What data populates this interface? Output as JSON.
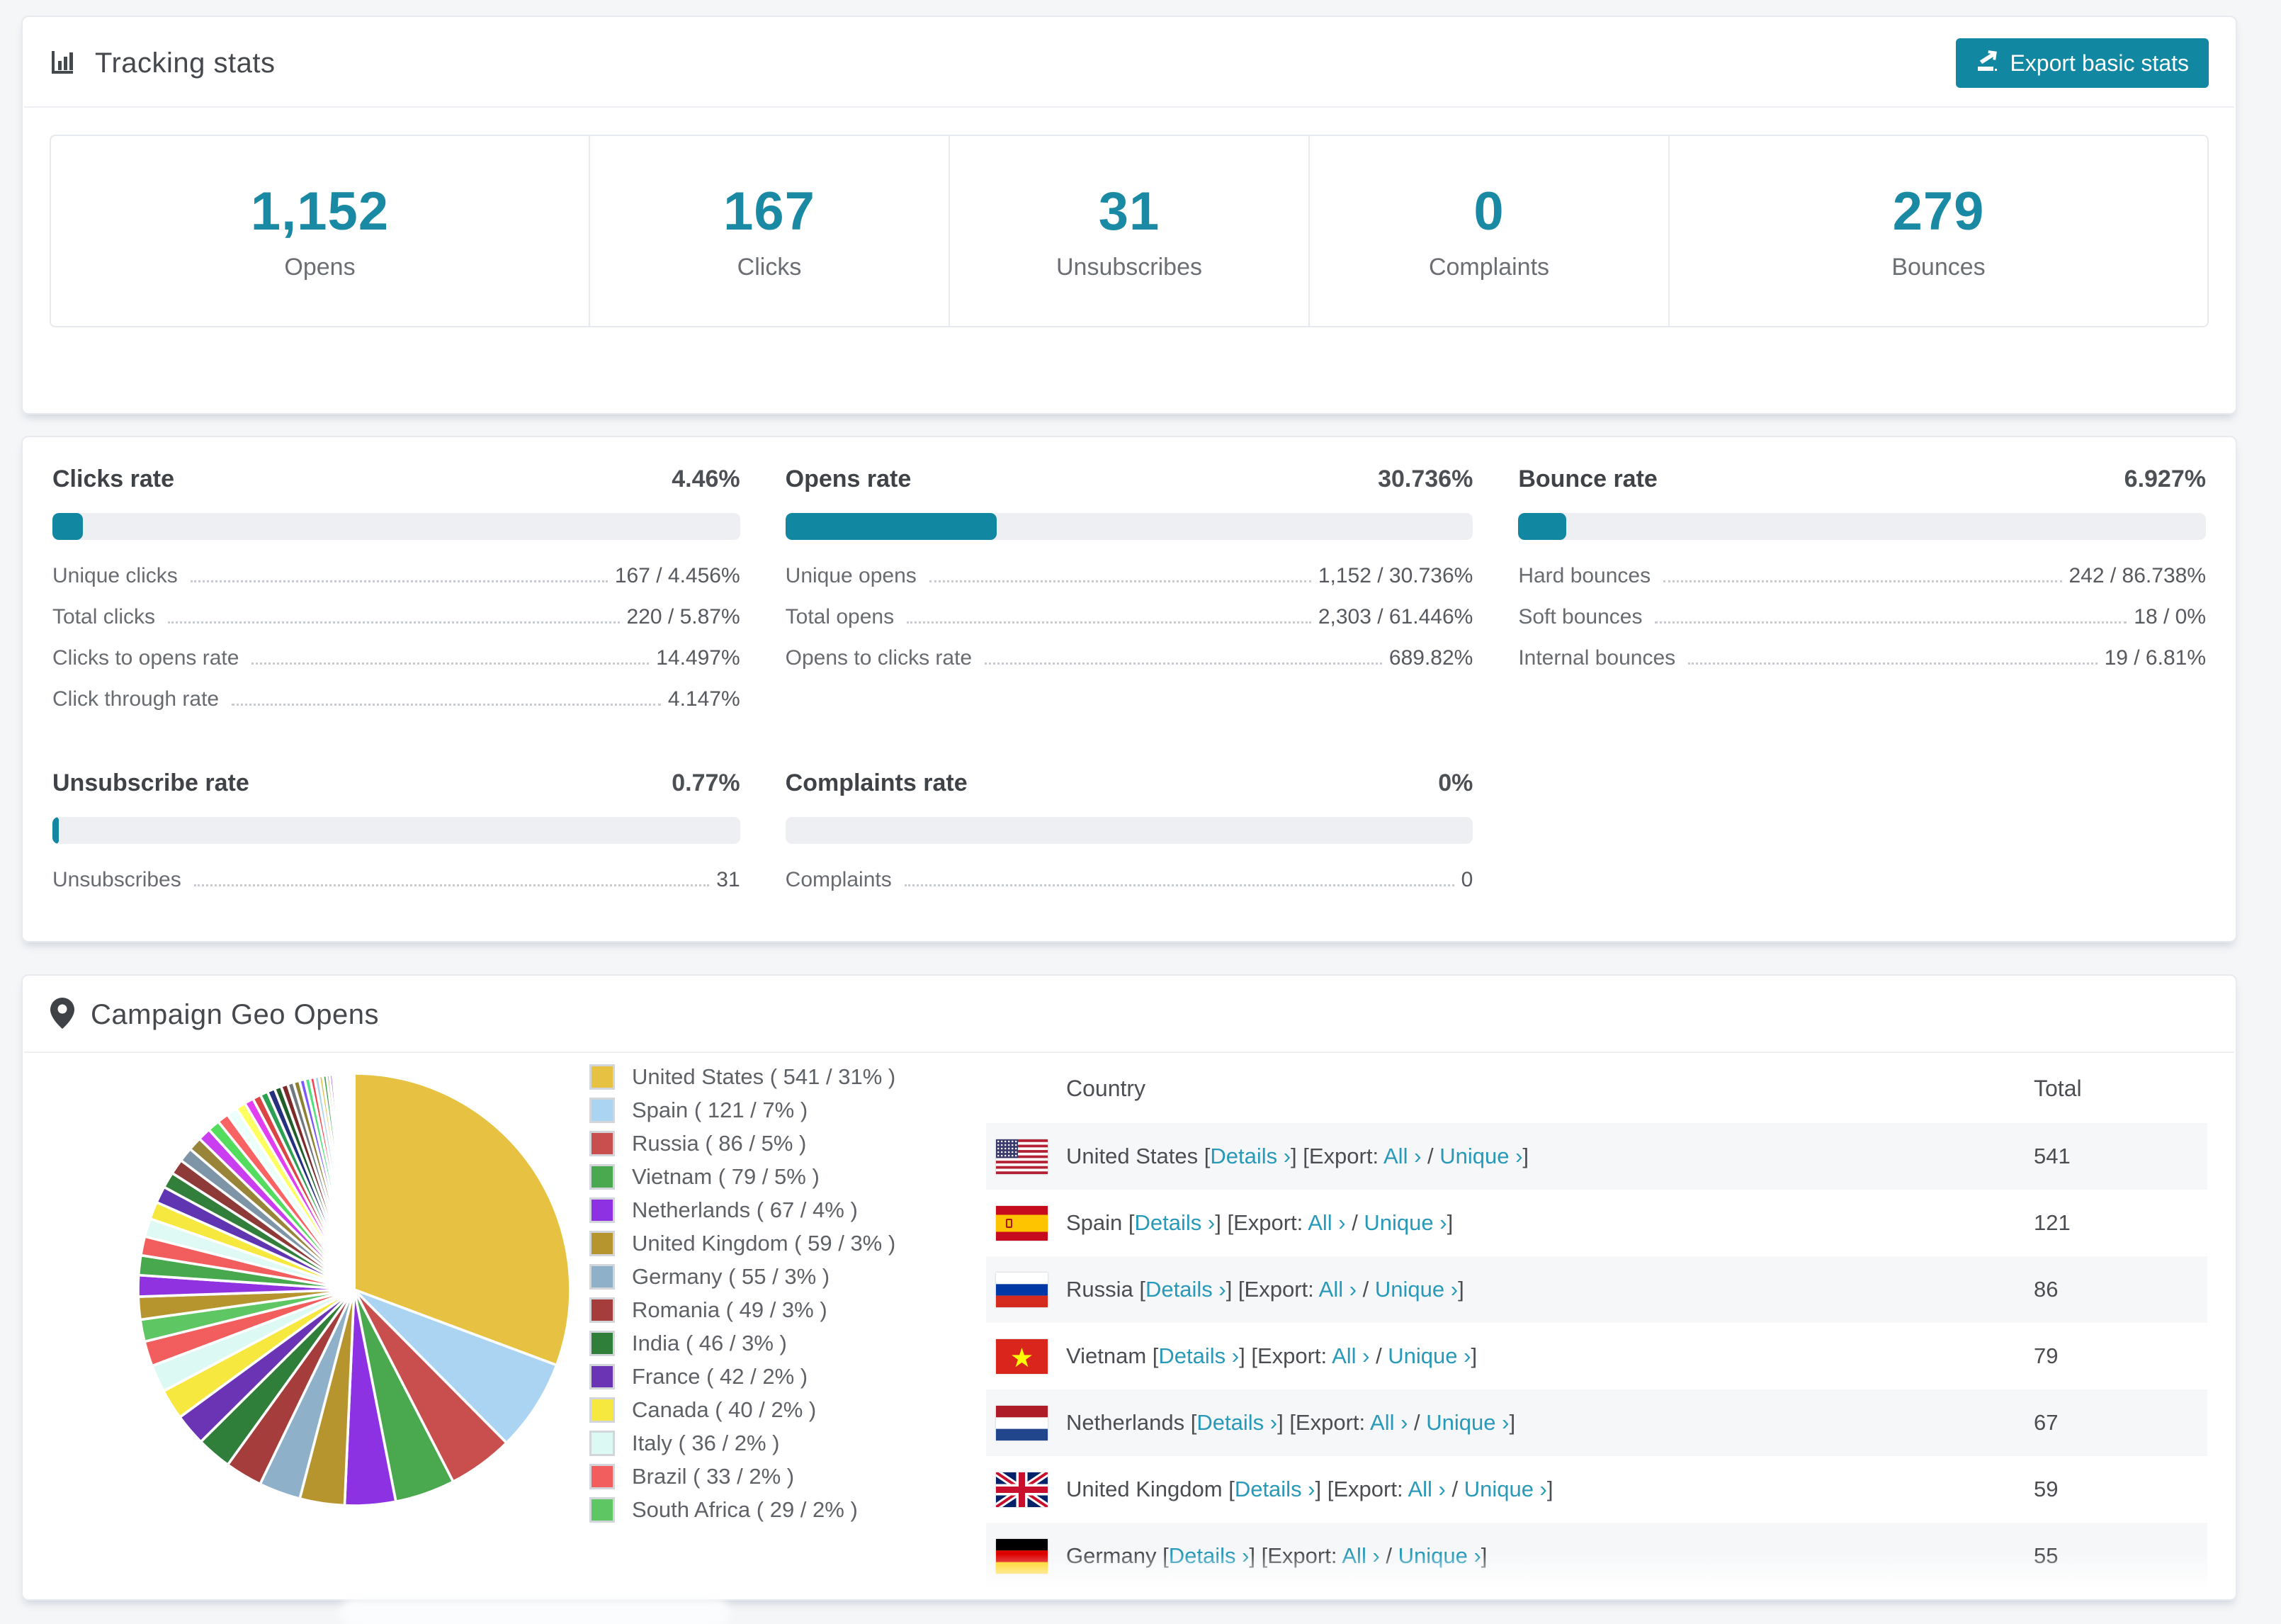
{
  "colors": {
    "accent_teal": "#1187a1",
    "number_teal": "#1a89a3",
    "link_teal": "#2899b9",
    "bar_track": "#edeff2",
    "row_stripe": "#f6f7f9"
  },
  "tracking": {
    "title": "Tracking stats",
    "export_button": "Export basic stats",
    "stats": [
      {
        "value": "1,152",
        "label": "Opens"
      },
      {
        "value": "167",
        "label": "Clicks"
      },
      {
        "value": "31",
        "label": "Unsubscribes"
      },
      {
        "value": "0",
        "label": "Complaints"
      },
      {
        "value": "279",
        "label": "Bounces"
      }
    ]
  },
  "rates": {
    "sections": [
      {
        "title": "Clicks rate",
        "value": "4.46%",
        "percent": 4.46,
        "rows": [
          {
            "label": "Unique clicks",
            "value": "167 / 4.456%"
          },
          {
            "label": "Total clicks",
            "value": "220 / 5.87%"
          },
          {
            "label": "Clicks to opens rate",
            "value": "14.497%"
          },
          {
            "label": "Click through rate",
            "value": "4.147%"
          }
        ]
      },
      {
        "title": "Opens rate",
        "value": "30.736%",
        "percent": 30.736,
        "rows": [
          {
            "label": "Unique opens",
            "value": "1,152 / 30.736%"
          },
          {
            "label": "Total opens",
            "value": "2,303 / 61.446%"
          },
          {
            "label": "Opens to clicks rate",
            "value": "689.82%"
          }
        ]
      },
      {
        "title": "Bounce rate",
        "value": "6.927%",
        "percent": 6.927,
        "rows": [
          {
            "label": "Hard bounces",
            "value": "242 / 86.738%"
          },
          {
            "label": "Soft bounces",
            "value": "18 / 0%"
          },
          {
            "label": "Internal bounces",
            "value": "19 / 6.81%"
          }
        ]
      },
      {
        "title": "Unsubscribe rate",
        "value": "0.77%",
        "percent": 0.77,
        "rows": [
          {
            "label": "Unsubscribes",
            "value": "31"
          }
        ]
      },
      {
        "title": "Complaints rate",
        "value": "0%",
        "percent": 0,
        "rows": [
          {
            "label": "Complaints",
            "value": "0"
          }
        ]
      }
    ]
  },
  "geo": {
    "title": "Campaign Geo Opens",
    "legend": [
      {
        "label": "United States ( 541 / 31% )",
        "color": "#e7c242"
      },
      {
        "label": "Spain ( 121 / 7% )",
        "color": "#abd4f3"
      },
      {
        "label": "Russia ( 86 / 5% )",
        "color": "#c84f4e"
      },
      {
        "label": "Vietnam ( 79 / 5% )",
        "color": "#4aa84f"
      },
      {
        "label": "Netherlands ( 67 / 4% )",
        "color": "#8d32e2"
      },
      {
        "label": "United Kingdom ( 59 / 3% )",
        "color": "#b6952e"
      },
      {
        "label": "Germany ( 55 / 3% )",
        "color": "#8fb0c9"
      },
      {
        "label": "Romania ( 49 / 3% )",
        "color": "#a43d3b"
      },
      {
        "label": "India ( 46 / 3% )",
        "color": "#2f7f3a"
      },
      {
        "label": "France ( 42 / 2% )",
        "color": "#6a34b4"
      },
      {
        "label": "Canada ( 40 / 2% )",
        "color": "#f6e83e"
      },
      {
        "label": "Italy ( 36 / 2% )",
        "color": "#dcfaf3"
      },
      {
        "label": "Brazil ( 33 / 2% )",
        "color": "#f25d5d"
      },
      {
        "label": "South Africa ( 29 / 2% )",
        "color": "#5ec763"
      }
    ],
    "table": {
      "headers": {
        "country": "Country",
        "total": "Total"
      },
      "fmt": {
        "open": " [",
        "close": "]",
        "details": "Details ›",
        "export": "[Export: ",
        "all": "All ›",
        "sep": " / ",
        "unique": "Unique ›",
        "space": " "
      },
      "rows": [
        {
          "country": "United States",
          "flag": "us",
          "total": "541"
        },
        {
          "country": "Spain",
          "flag": "es",
          "total": "121"
        },
        {
          "country": "Russia",
          "flag": "ru",
          "total": "86"
        },
        {
          "country": "Vietnam",
          "flag": "vn",
          "total": "79"
        },
        {
          "country": "Netherlands",
          "flag": "nl",
          "total": "67"
        },
        {
          "country": "United Kingdom",
          "flag": "gb",
          "total": "59"
        },
        {
          "country": "Germany",
          "flag": "de",
          "total": "55",
          "partial": true
        }
      ]
    }
  },
  "chart_data": {
    "type": "pie",
    "title": "Campaign Geo Opens",
    "legend_position": "right",
    "start_angle_deg": 0,
    "direction": "clockwise",
    "labeled_slices": [
      {
        "label": "United States",
        "value": 541,
        "pct": "31%",
        "color": "#e7c242"
      },
      {
        "label": "Spain",
        "value": 121,
        "pct": "7%",
        "color": "#abd4f3"
      },
      {
        "label": "Russia",
        "value": 86,
        "pct": "5%",
        "color": "#c84f4e"
      },
      {
        "label": "Vietnam",
        "value": 79,
        "pct": "5%",
        "color": "#4aa84f"
      },
      {
        "label": "Netherlands",
        "value": 67,
        "pct": "4%",
        "color": "#8d32e2"
      },
      {
        "label": "United Kingdom",
        "value": 59,
        "pct": "3%",
        "color": "#b6952e"
      },
      {
        "label": "Germany",
        "value": 55,
        "pct": "3%",
        "color": "#8fb0c9"
      },
      {
        "label": "Romania",
        "value": 49,
        "pct": "3%",
        "color": "#a43d3b"
      },
      {
        "label": "India",
        "value": 46,
        "pct": "3%",
        "color": "#2f7f3a"
      },
      {
        "label": "France",
        "value": 42,
        "pct": "2%",
        "color": "#6a34b4"
      },
      {
        "label": "Canada",
        "value": 40,
        "pct": "2%",
        "color": "#f6e83e"
      },
      {
        "label": "Italy",
        "value": 36,
        "pct": "2%",
        "color": "#dcfaf3"
      },
      {
        "label": "Brazil",
        "value": 33,
        "pct": "2%",
        "color": "#f25d5d"
      },
      {
        "label": "South Africa",
        "value": 29,
        "pct": "2%",
        "color": "#5ec763"
      }
    ],
    "other_slices": {
      "note": "many small unlabeled countries fanning to 12 o'clock",
      "values": [
        30,
        28,
        26,
        25,
        24,
        23,
        22,
        21,
        20,
        19,
        18,
        17,
        16,
        15,
        14,
        13,
        12,
        11,
        10,
        10,
        9,
        9,
        8,
        8,
        7,
        7,
        6,
        6,
        5,
        5,
        4,
        4,
        3,
        3,
        3,
        2,
        2,
        2,
        2,
        1,
        1,
        1,
        1,
        1,
        1,
        1,
        1,
        1,
        1,
        1
      ],
      "colors": [
        "#b6952e",
        "#9032e0",
        "#47a84e",
        "#f25d5d",
        "#dffaf4",
        "#f6e83e",
        "#5f35b2",
        "#317f3b",
        "#8e3a38",
        "#7e94a7",
        "#99853a",
        "#c93ff0",
        "#54dc5f",
        "#fa6363",
        "#ebfffb",
        "#feff60",
        "#e23ef2",
        "#dc4545",
        "#2ba052",
        "#25317e",
        "#1f5f2a",
        "#7d2a2a",
        "#70787f",
        "#8d8030",
        "#7e58ff",
        "#52e07e",
        "#f24855",
        "#abd4f3",
        "#e3bf49",
        "#41a04e"
      ]
    }
  }
}
